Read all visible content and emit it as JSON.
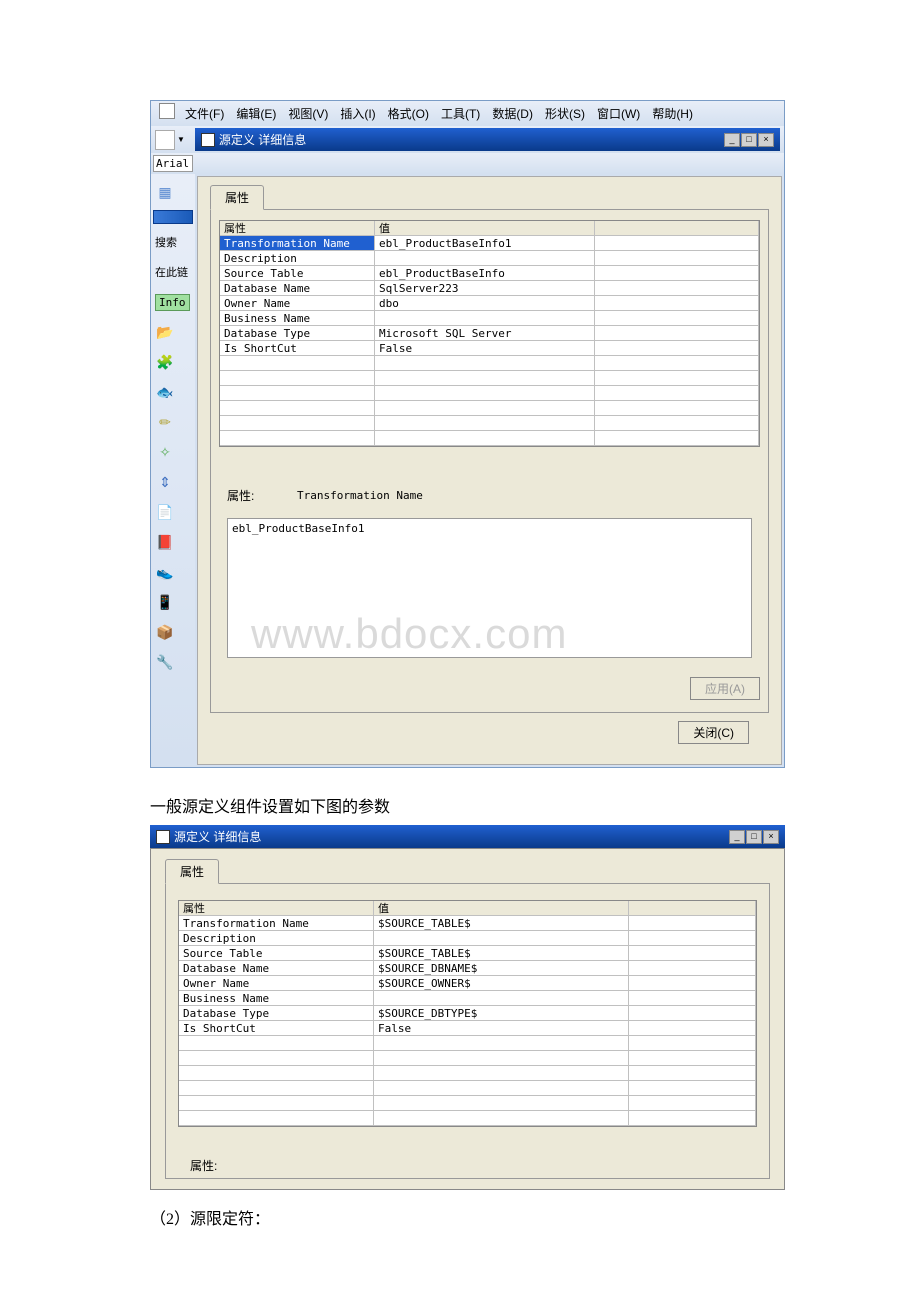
{
  "menubar": {
    "items": [
      {
        "label": "文件(F)"
      },
      {
        "label": "编辑(E)"
      },
      {
        "label": "视图(V)"
      },
      {
        "label": "插入(I)"
      },
      {
        "label": "格式(O)"
      },
      {
        "label": "工具(T)"
      },
      {
        "label": "数据(D)"
      },
      {
        "label": "形状(S)"
      },
      {
        "label": "窗口(W)"
      },
      {
        "label": "帮助(H)"
      }
    ]
  },
  "dialog": {
    "title": "源定义 详细信息",
    "tab": "属性",
    "cols": {
      "name": "属性",
      "value": "值"
    },
    "rows": [
      {
        "name": "Transformation Name",
        "value": "ebl_ProductBaseInfo1"
      },
      {
        "name": "Description",
        "value": ""
      },
      {
        "name": "Source Table",
        "value": "ebl_ProductBaseInfo"
      },
      {
        "name": "Database Name",
        "value": "SqlServer223"
      },
      {
        "name": "Owner Name",
        "value": "dbo"
      },
      {
        "name": "Business Name",
        "value": ""
      },
      {
        "name": "Database Type",
        "value": "Microsoft SQL Server"
      },
      {
        "name": "Is ShortCut",
        "value": "False"
      }
    ],
    "prop_label": "属性:",
    "prop_name": "Transformation Name",
    "prop_value": "ebl_ProductBaseInfo1",
    "apply": "应用(A)",
    "close": "关闭(C)"
  },
  "font": "Arial",
  "sidebar": {
    "search": "搜索",
    "here": "在此链",
    "info": "Info"
  },
  "watermark": "www.bdocx.com",
  "caption1": "一般源定义组件设置如下图的参数",
  "dialog2": {
    "title": "源定义 详细信息",
    "tab": "属性",
    "cols": {
      "name": "属性",
      "value": "值"
    },
    "rows": [
      {
        "name": "Transformation Name",
        "value": "$SOURCE_TABLE$"
      },
      {
        "name": "Description",
        "value": ""
      },
      {
        "name": "Source Table",
        "value": "$SOURCE_TABLE$"
      },
      {
        "name": "Database Name",
        "value": "$SOURCE_DBNAME$"
      },
      {
        "name": "Owner Name",
        "value": "$SOURCE_OWNER$"
      },
      {
        "name": "Business Name",
        "value": ""
      },
      {
        "name": "Database Type",
        "value": "$SOURCE_DBTYPE$"
      },
      {
        "name": "Is ShortCut",
        "value": "False"
      }
    ],
    "prop_label": "属性:"
  },
  "caption2": "（2）源限定符："
}
